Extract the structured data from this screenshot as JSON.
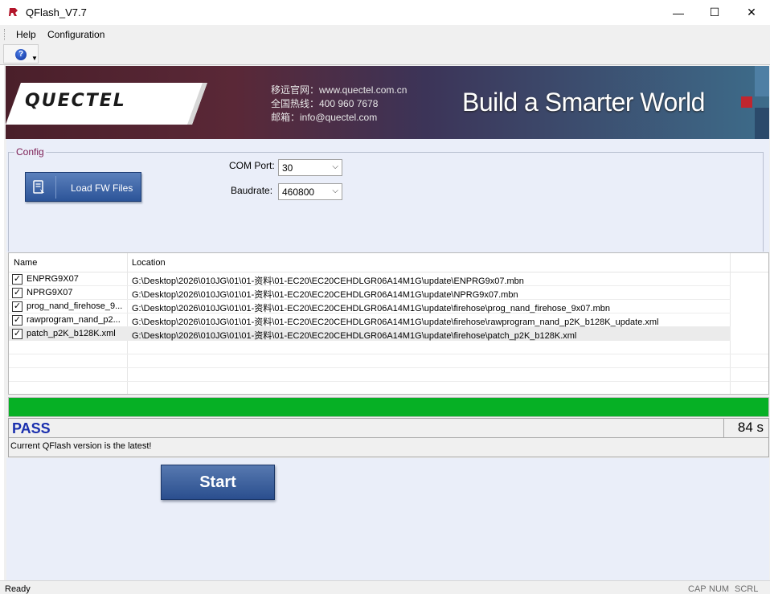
{
  "window": {
    "title": "QFlash_V7.7",
    "minimize": "—",
    "maximize": "☐",
    "close": "✕"
  },
  "menu": {
    "help": "Help",
    "configuration": "Configuration"
  },
  "toolbar": {
    "help_icon": "help-icon"
  },
  "banner": {
    "logo": "QUECTEL",
    "website": "移远官网：www.quectel.com.cn",
    "hotline": "全国热线：400 960 7678",
    "email": "邮箱：info@quectel.com",
    "slogan": "Build a Smarter World"
  },
  "config": {
    "legend": "Config",
    "load_button": "Load FW Files",
    "com_port_label": "COM Port:",
    "com_port_value": "30",
    "baudrate_label": "Baudrate:",
    "baudrate_value": "460800"
  },
  "file_list": {
    "columns": [
      "Name",
      "Location"
    ],
    "rows": [
      {
        "checked": true,
        "name": "ENPRG9X07",
        "location": "G:\\Desktop\\2026\\010JG\\01\\01-资料\\01-EC20\\EC20CEHDLGR06A14M1G\\update\\ENPRG9x07.mbn"
      },
      {
        "checked": true,
        "name": "NPRG9X07",
        "location": "G:\\Desktop\\2026\\010JG\\01\\01-资料\\01-EC20\\EC20CEHDLGR06A14M1G\\update\\NPRG9x07.mbn"
      },
      {
        "checked": true,
        "name": "prog_nand_firehose_9...",
        "location": "G:\\Desktop\\2026\\010JG\\01\\01-资料\\01-EC20\\EC20CEHDLGR06A14M1G\\update\\firehose\\prog_nand_firehose_9x07.mbn"
      },
      {
        "checked": true,
        "name": "rawprogram_nand_p2...",
        "location": "G:\\Desktop\\2026\\010JG\\01\\01-资料\\01-EC20\\EC20CEHDLGR06A14M1G\\update\\firehose\\rawprogram_nand_p2K_b128K_update.xml"
      },
      {
        "checked": true,
        "name": "patch_p2K_b128K.xml",
        "location": "G:\\Desktop\\2026\\010JG\\01\\01-资料\\01-EC20\\EC20CEHDLGR06A14M1G\\update\\firehose\\patch_p2K_b128K.xml"
      }
    ]
  },
  "progress": {
    "percent": 100,
    "color": "#06b025"
  },
  "status": {
    "result": "PASS",
    "elapsed": "84 s",
    "message": "Current QFlash version is the latest!"
  },
  "actions": {
    "start": "Start"
  },
  "statusbar": {
    "ready": "Ready",
    "cap": "CAP",
    "num": "NUM",
    "scrl": "SCRL"
  }
}
